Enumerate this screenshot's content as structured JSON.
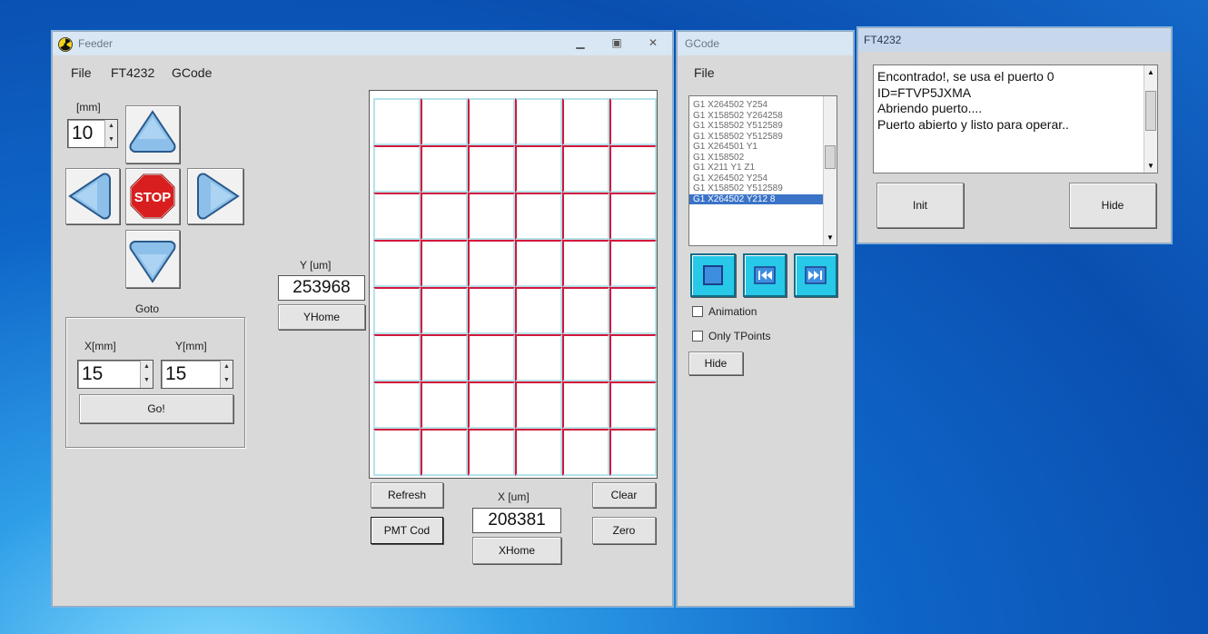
{
  "feeder": {
    "title": "Feeder",
    "menu": [
      "File",
      "FT4232",
      "GCode"
    ],
    "step": {
      "label": "[mm]",
      "value": "10"
    },
    "stop_label": "STOP",
    "y_readout": {
      "label": "Y [um]",
      "value": "253968",
      "home_label": "YHome"
    },
    "goto": {
      "legend": "Goto",
      "x_label": "X[mm]",
      "x_value": "15",
      "y_label": "Y[mm]",
      "y_value": "15",
      "go_label": "Go!"
    },
    "buttons": {
      "refresh": "Refresh",
      "pmt_cod": "PMT Cod",
      "clear": "Clear",
      "zero": "Zero"
    },
    "x_readout": {
      "label": "X [um]",
      "value": "208381",
      "home_label": "XHome"
    }
  },
  "gcode": {
    "title": "GCode",
    "menu": [
      "File"
    ],
    "lines": [
      "G1 X264502 Y254",
      "G1 X158502 Y264258",
      "G1 X158502 Y512589",
      "G1 X158502 Y512589",
      "G1 X264501 Y1",
      "G1 X158502",
      "G1 X211 Y1 Z1",
      "G1 X264502 Y254",
      "G1 X158502 Y512589",
      "G1 X264502 Y212 8"
    ],
    "selected_index": 9,
    "animation_label": "Animation",
    "only_tpoints_label": "Only TPoints",
    "hide_label": "Hide"
  },
  "ft4232": {
    "title": "FT4232",
    "log": [
      "Encontrado!, se usa el puerto 0",
      "ID=FTVP5JXMA",
      "Abriendo puerto....",
      "Puerto abierto y listo para operar.."
    ],
    "init_label": "Init",
    "hide_label": "Hide"
  },
  "colors": {
    "grid_red": "#d4163c",
    "grid_cyan": "#b5e3ea",
    "titlebar": "#d9e6f3",
    "accent_blue": "#3a8fd8"
  }
}
